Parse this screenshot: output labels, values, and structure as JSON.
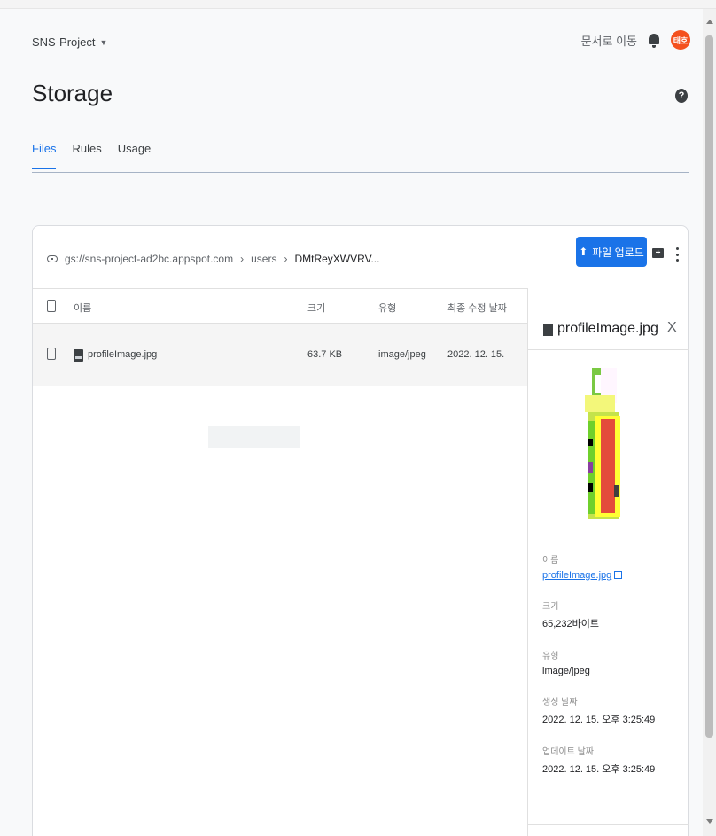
{
  "header": {
    "project": "SNS-Project",
    "docs_link": "문서로 이동",
    "avatar_text": "태호"
  },
  "page": {
    "title": "Storage"
  },
  "tabs": [
    {
      "label": "Files",
      "active": true
    },
    {
      "label": "Rules",
      "active": false
    },
    {
      "label": "Usage",
      "active": false
    }
  ],
  "breadcrumb": {
    "bucket": "gs://sns-project-ad2bc.appspot.com",
    "folder": "users",
    "current": "DMtReyXWVRV..."
  },
  "toolbar": {
    "upload_label": "파일 업로드"
  },
  "table": {
    "columns": [
      "이름",
      "크기",
      "유형",
      "최종 수정 날짜"
    ],
    "rows": [
      {
        "name": "profileImage.jpg",
        "size": "63.7 KB",
        "type": "image/jpeg",
        "modified": "2022. 12. 15."
      }
    ]
  },
  "details": {
    "title": "profileImage.jpg",
    "close": "X",
    "fields": {
      "name_label": "이름",
      "name_value": "profileImage.jpg",
      "size_label": "크기",
      "size_value": "65,232바이트",
      "type_label": "유형",
      "type_value": "image/jpeg",
      "created_label": "생성 날짜",
      "created_value": "2022. 12. 15. 오후 3:25:49",
      "updated_label": "업데이트 날짜",
      "updated_value": "2022. 12. 15. 오후 3:25:49"
    }
  },
  "colors": {
    "primary": "#1a73e8",
    "avatar": "#f4511e",
    "purple_bg": "#6a00e8"
  }
}
